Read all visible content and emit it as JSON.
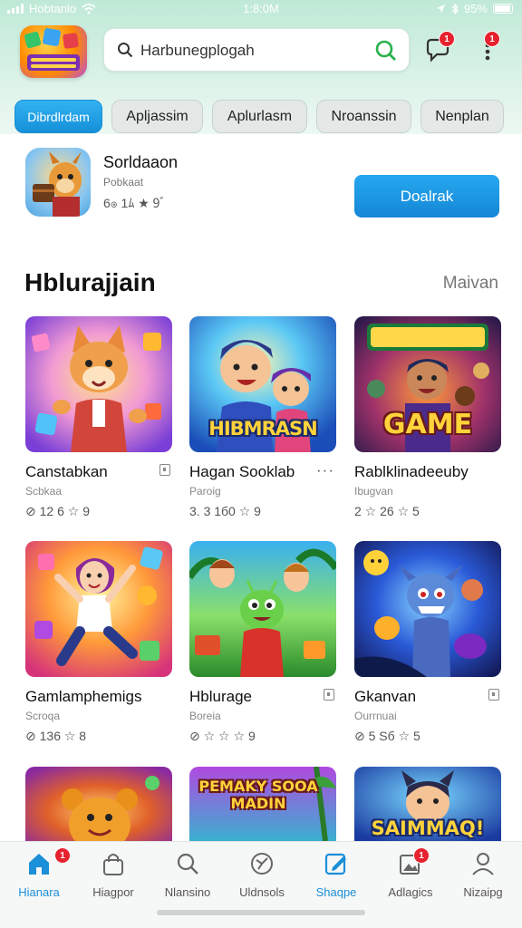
{
  "status_bar": {
    "carrier": "Hobtanlo",
    "time": "1:8:0M",
    "battery": "95%"
  },
  "header": {
    "search_placeholder": "Harbunegplogah",
    "chat_badge": "1",
    "menu_badge": "1"
  },
  "chips": [
    {
      "label": "Dibrdlrdam",
      "active": true
    },
    {
      "label": "Apljassim",
      "active": false
    },
    {
      "label": "Aplurlasm",
      "active": false
    },
    {
      "label": "Nroanssin",
      "active": false
    },
    {
      "label": "Nenplan",
      "active": false
    }
  ],
  "featured": {
    "title": "Sorldaaon",
    "subtitle": "Pobkaat",
    "meta": "6ၜ 1ﾑ ★ 9ﾞ",
    "button_label": "Doalrak"
  },
  "section": {
    "title": "Hblurajjain",
    "link": "Maivan"
  },
  "games": [
    {
      "title": "Canstabkan",
      "subtitle": "Scbkaa",
      "meta": "⊘ 12 6 ☆ 9",
      "menu": "box",
      "image": "fox-cartoon"
    },
    {
      "title": "Hagan Sooklab",
      "subtitle": "Paroig",
      "meta": "3. 3 1б0 ☆ 9",
      "menu": "dots",
      "image": "hibmrasn-kids",
      "art_text": "HIBMRASN"
    },
    {
      "title": "Rablklinadeeuby",
      "subtitle": "Ibugvan",
      "meta": "2 ☆ 26 ☆ 5",
      "menu": "none",
      "image": "game-arcade",
      "art_text": "GAME"
    },
    {
      "title": "Gamlamphemigs",
      "subtitle": "Scroqa",
      "meta": "⊘ 136 ☆ 8",
      "menu": "none",
      "image": "dancing-girl"
    },
    {
      "title": "Hblurage",
      "subtitle": "Boreia",
      "meta": "⊘ ☆ ☆ ☆ 9",
      "menu": "box",
      "image": "green-alien"
    },
    {
      "title": "Gkanvan",
      "subtitle": "Ourrnuai",
      "meta": "⊘ 5 Sб ☆ 5",
      "menu": "box",
      "image": "blue-monster"
    },
    {
      "title": "",
      "subtitle": "",
      "meta": "",
      "menu": "none",
      "image": "bear-cartoon"
    },
    {
      "title": "",
      "subtitle": "",
      "meta": "",
      "menu": "none",
      "image": "pemaky-jungle",
      "art_text": "PEMAKY SOOA MADIN"
    },
    {
      "title": "",
      "subtitle": "",
      "meta": "",
      "menu": "none",
      "image": "saimmaq-boy",
      "art_text": "SAIMMAQ!"
    }
  ],
  "bottom_nav": [
    {
      "label": "Hianara",
      "icon": "home-icon",
      "active": true,
      "badge": "1"
    },
    {
      "label": "Hiagpor",
      "icon": "bag-icon",
      "active": false,
      "badge": ""
    },
    {
      "label": "Nlansino",
      "icon": "search-icon",
      "active": false,
      "badge": ""
    },
    {
      "label": "Uldnsols",
      "icon": "gauge-icon",
      "active": false,
      "badge": ""
    },
    {
      "label": "Shaqpe",
      "icon": "edit-icon",
      "active": false,
      "badge": ""
    },
    {
      "label": "Adlagics",
      "icon": "gallery-icon",
      "active": false,
      "badge": "1"
    },
    {
      "label": "Nizaipg",
      "icon": "profile-icon",
      "active": false,
      "badge": ""
    }
  ],
  "colors": {
    "accent": "#1b8fd8",
    "badge": "#e5222e",
    "header_bg": "#bfe9d6"
  }
}
